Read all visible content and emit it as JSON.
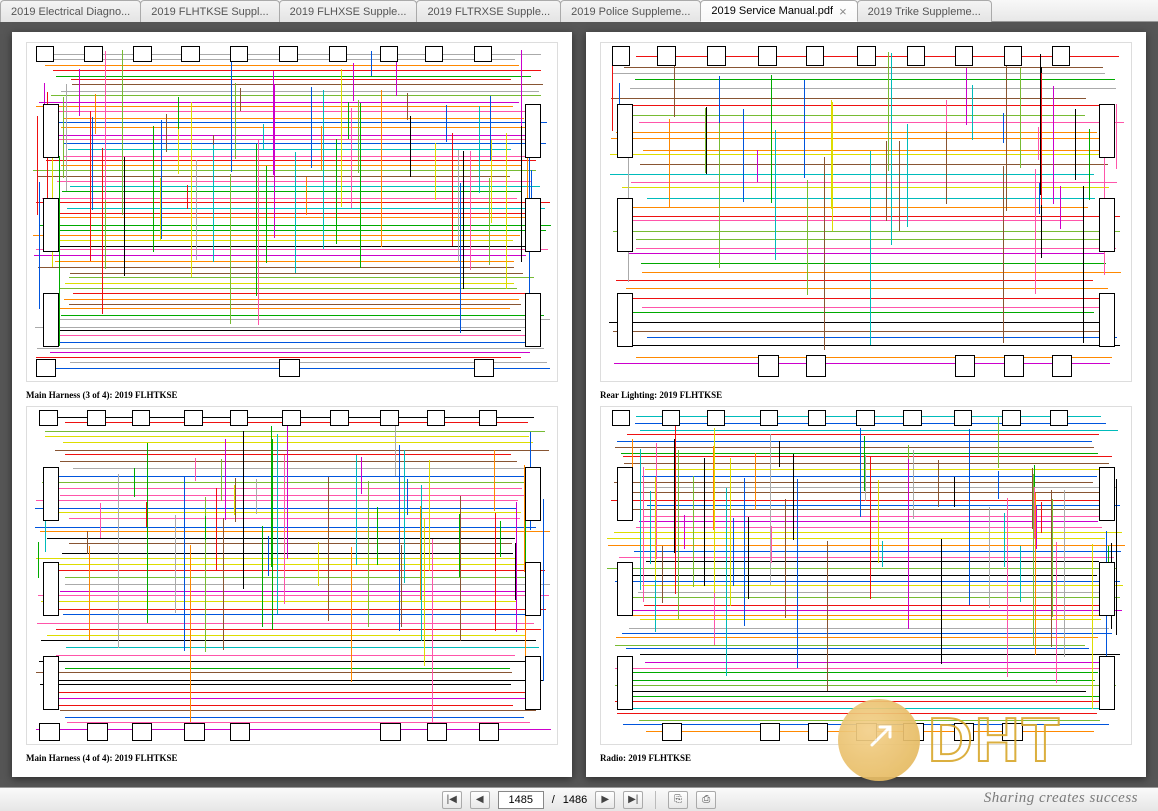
{
  "tabs": [
    {
      "label": "2019 Electrical Diagno...",
      "active": false
    },
    {
      "label": "2019 FLHTKSE Suppl...",
      "active": false
    },
    {
      "label": "2019 FLHXSE Supple...",
      "active": false
    },
    {
      "label": "2019 FLTRXSE Supple...",
      "active": false
    },
    {
      "label": "2019 Police Suppleme...",
      "active": false
    },
    {
      "label": "2019 Service Manual.pdf",
      "active": true
    },
    {
      "label": "2019 Trike Suppleme...",
      "active": false
    }
  ],
  "page_left": {
    "diagrams": [
      {
        "caption": "Main Harness (3 of 4): 2019 FLHTKSE"
      },
      {
        "caption": "Main Harness (4 of 4): 2019 FLHTKSE"
      }
    ]
  },
  "page_right": {
    "diagrams": [
      {
        "caption": "Rear Lighting: 2019 FLHTKSE"
      },
      {
        "caption": "Radio: 2019 FLHTKSE"
      }
    ]
  },
  "wire_colors": [
    "#e11",
    "#0a0",
    "#05d",
    "#c0c",
    "#f80",
    "#853",
    "#aaa",
    "#000",
    "#dd0",
    "#0bb",
    "#f5a",
    "#7b3"
  ],
  "nav": {
    "first": "|◀",
    "prev": "◀",
    "next": "▶",
    "last": "▶|",
    "page_current": "1485",
    "page_total": "1486",
    "sep": "/",
    "icon_a": "⎘",
    "icon_b": "⎙"
  },
  "watermark": {
    "text": "DHT",
    "tagline": "Sharing creates success"
  }
}
